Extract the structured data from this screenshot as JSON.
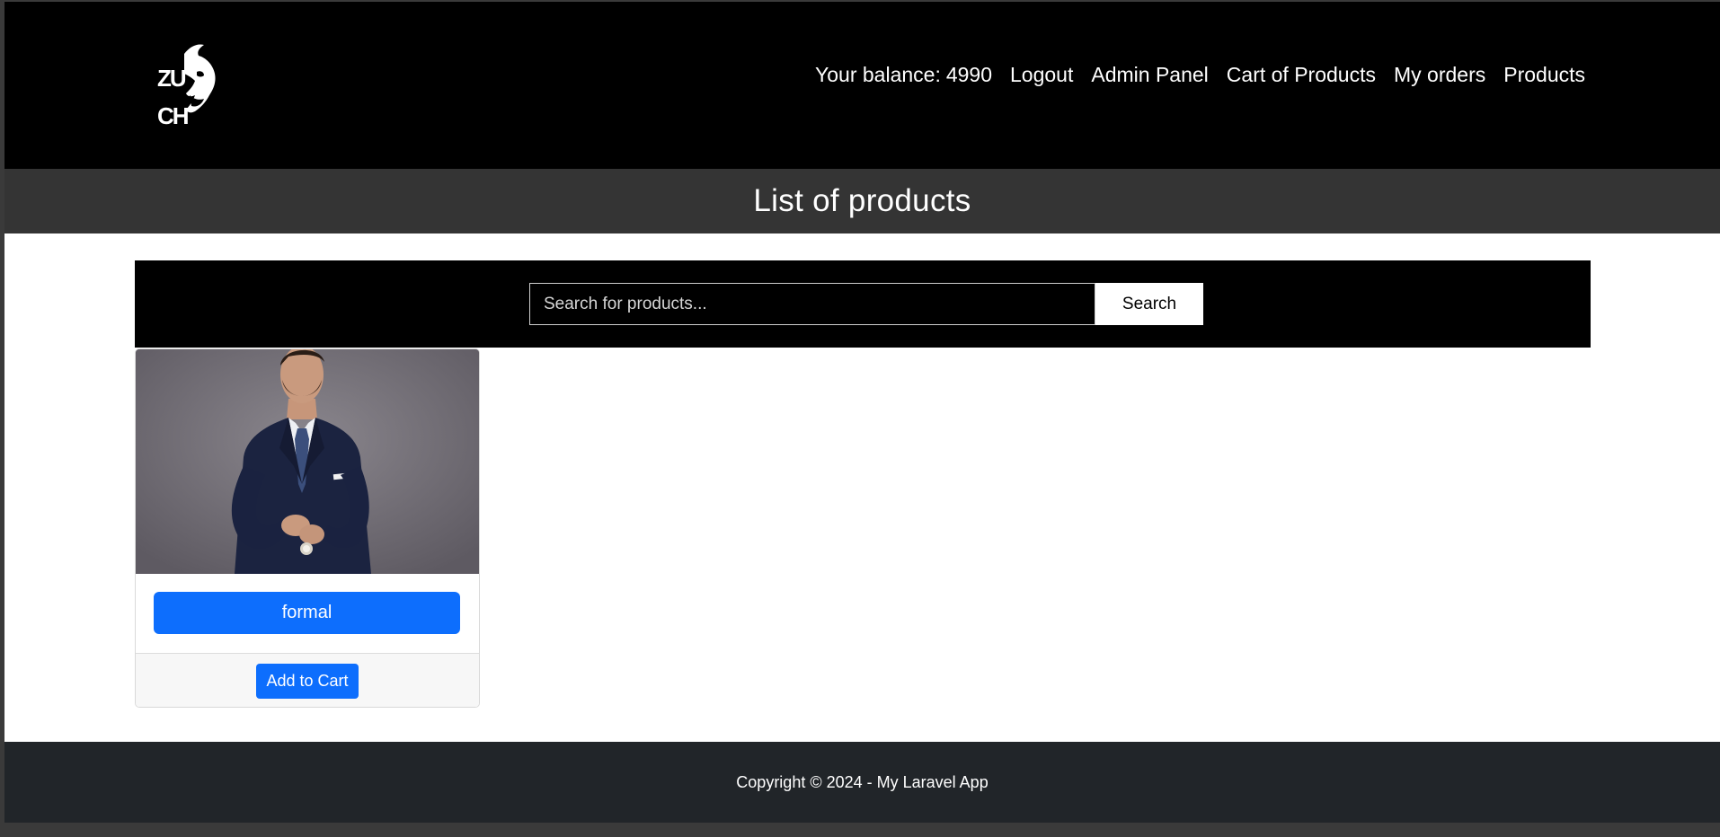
{
  "colors": {
    "navbar_bg": "#000000",
    "title_band_bg": "#343434",
    "primary": "#0d6efd",
    "footer_bg": "#212529"
  },
  "header": {
    "logo_icon": "zuch-bull-logo-icon",
    "balance_label": "Your balance:",
    "balance_value": "4990",
    "nav": {
      "logout": "Logout",
      "admin_panel": "Admin Panel",
      "cart": "Cart of Products",
      "my_orders": "My orders",
      "products": "Products"
    }
  },
  "page": {
    "title": "List of products"
  },
  "search": {
    "placeholder": "Search for products...",
    "value": "",
    "button_label": "Search"
  },
  "products": [
    {
      "name": "formal",
      "image_icon": "man-in-formal-suit-photo",
      "add_to_cart_label": "Add to Cart"
    }
  ],
  "footer": {
    "copyright": "Copyright © 2024 - My Laravel App"
  }
}
